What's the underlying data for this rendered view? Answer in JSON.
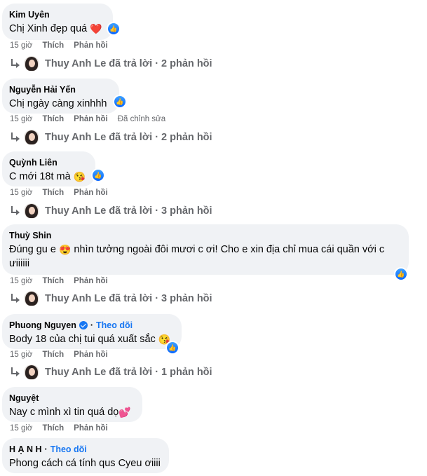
{
  "comments": [
    {
      "author": "Kim Uyên",
      "text": "Chị Xinh đẹp quá",
      "emoji": "❤️",
      "time": "15 giờ",
      "like": "Thích",
      "reply": "Phản hồi",
      "replies_summary": {
        "replier": "Thuy Anh Le",
        "text": "Thuy Anh Le đã trả lời · 2 phản hồi"
      }
    },
    {
      "author": "Nguyễn Hải Yến",
      "text": "Chị ngày càng xinhhh",
      "time": "15 giờ",
      "like": "Thích",
      "reply": "Phản hồi",
      "edited": "Đã chỉnh sửa",
      "replies_summary": {
        "replier": "Thuy Anh Le",
        "text": "Thuy Anh Le đã trả lời · 2 phản hồi"
      }
    },
    {
      "author": "Quỳnh Liên",
      "text": "C mới 18t mà",
      "emoji": "😘",
      "time": "15 giờ",
      "like": "Thích",
      "reply": "Phản hồi",
      "replies_summary": {
        "replier": "Thuy Anh Le",
        "text": "Thuy Anh Le đã trả lời · 3 phản hồi"
      }
    },
    {
      "author": "Thuỳ Shin",
      "text_a": "Đúng gu e",
      "emoji": "😍",
      "text_b": "nhìn tưởng ngoài đôi mươi c ơi! Cho e xin địa chỉ mua cái quần với c",
      "text_c": "ưiiiiii",
      "time": "15 giờ",
      "like": "Thích",
      "reply": "Phản hồi",
      "replies_summary": {
        "replier": "Thuy Anh Le",
        "text": "Thuy Anh Le đã trả lời · 3 phản hồi"
      }
    },
    {
      "author": "Phuong Nguyen",
      "follow": "Theo dõi",
      "text": "Body 18 của chị tui quá xuất sắc",
      "emoji": "😘",
      "time": "15 giờ",
      "like": "Thích",
      "reply": "Phản hồi",
      "replies_summary": {
        "replier": "Thuy Anh Le",
        "text": "Thuy Anh Le đã trả lời · 1 phản hồi"
      }
    },
    {
      "author": "Nguyệt",
      "text": "Nay c mình xì tin quá dọ",
      "emoji": "💕",
      "time": "15 giờ",
      "like": "Thích",
      "reply": "Phản hồi"
    },
    {
      "author": "H Ạ N H",
      "follow": "Theo dõi",
      "text": "Phong cách cá tính qus Cyeu ơiiii"
    }
  ],
  "colors": {
    "bubble": "#f0f2f5",
    "meta": "#65676b",
    "accent": "#1877f2"
  },
  "icons": {
    "like": "thumbs-up-icon",
    "reply_arrow": "reply-arrow-icon",
    "verified": "verified-badge-icon"
  }
}
